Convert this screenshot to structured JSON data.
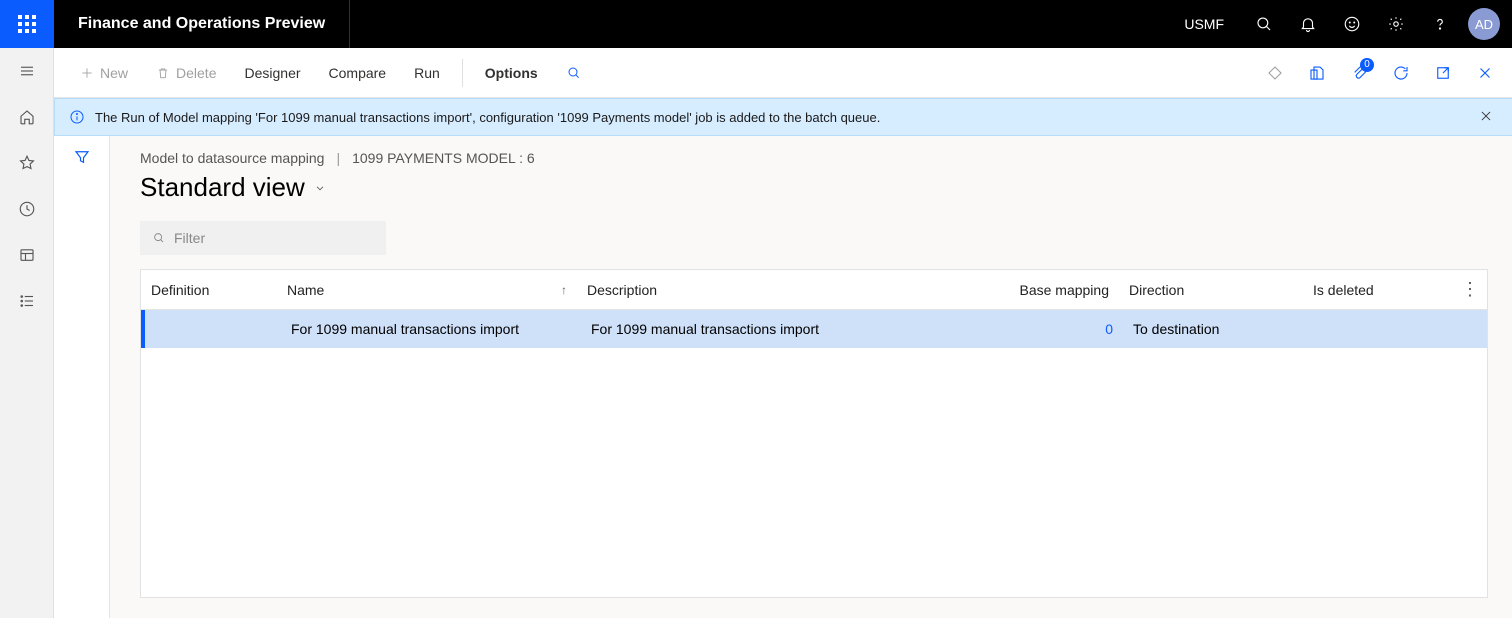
{
  "header": {
    "app_title": "Finance and Operations Preview",
    "company": "USMF",
    "avatar": "AD"
  },
  "actionbar": {
    "new": "New",
    "delete": "Delete",
    "designer": "Designer",
    "compare": "Compare",
    "run": "Run",
    "options": "Options",
    "attachments_badge": "0"
  },
  "info": {
    "message": "The Run of Model mapping 'For 1099 manual transactions import', configuration '1099 Payments model' job is added to the batch queue."
  },
  "page": {
    "breadcrumb1": "Model to datasource mapping",
    "breadcrumb2": "1099 PAYMENTS MODEL : 6",
    "view_title": "Standard view",
    "filter_placeholder": "Filter"
  },
  "grid": {
    "columns": {
      "definition": "Definition",
      "name": "Name",
      "description": "Description",
      "base_mapping": "Base mapping",
      "direction": "Direction",
      "is_deleted": "Is deleted"
    },
    "rows": [
      {
        "definition": "",
        "name": "For 1099 manual transactions import",
        "description": "For 1099 manual transactions import",
        "base_mapping": "0",
        "direction": "To destination",
        "is_deleted": ""
      }
    ]
  }
}
